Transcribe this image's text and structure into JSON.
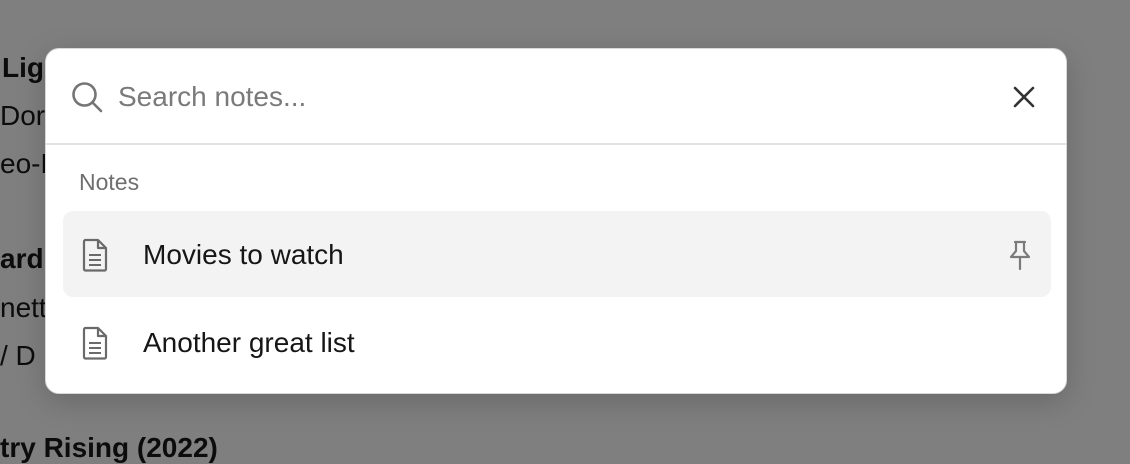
{
  "background": {
    "fragments": [
      "Lig",
      "Dor",
      "eo-N",
      "ard",
      "nett",
      "/ D",
      "try Rising (2022)"
    ]
  },
  "palette": {
    "search": {
      "placeholder": "Search notes...",
      "value": ""
    },
    "section_label": "Notes",
    "notes": [
      {
        "title": "Movies to watch",
        "pinned": true,
        "active": true
      },
      {
        "title": "Another great list",
        "pinned": false,
        "active": false
      }
    ]
  },
  "colors": {
    "overlay": "#7f7f7f",
    "dialog": "#ffffff",
    "active_row": "#f3f3f3",
    "muted_text": "#6f6f6f"
  },
  "icons": {
    "search": "search-icon",
    "close": "close-icon",
    "note": "document-icon",
    "pin": "pin-icon"
  }
}
